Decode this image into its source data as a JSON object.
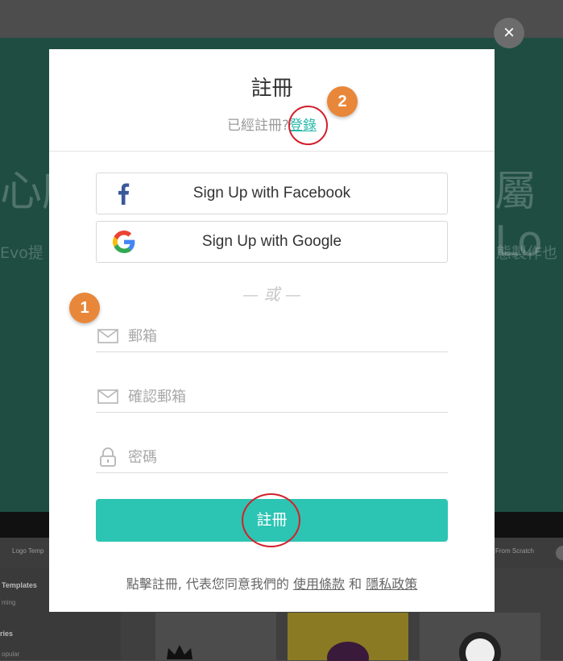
{
  "background": {
    "hero_left": "心所",
    "hero_right": "屬Lo",
    "hero_sub_left": "Evo提",
    "hero_sub_right": "態製作也",
    "nav_left": "Logo Temp",
    "nav_right": "From Scratch",
    "side_items": [
      "Templates",
      "ming",
      "ries",
      "opular"
    ]
  },
  "modal": {
    "close_label": "×",
    "title": "註冊",
    "already_registered": "已經註冊?",
    "login_link": "登錄",
    "facebook_label": "Sign Up with Facebook",
    "google_label": "Sign Up with Google",
    "or_text": "— 或 —",
    "email_placeholder": "郵箱",
    "confirm_email_placeholder": "確認郵箱",
    "password_placeholder": "密碼",
    "submit_label": "註冊",
    "terms_prefix": "點擊註冊, 代表您同意我們的",
    "terms_link": "使用條款",
    "terms_and": "和",
    "privacy_link": "隱私政策"
  },
  "annotations": {
    "badge_1": "1",
    "badge_2": "2"
  },
  "colors": {
    "accent": "#2cc4b3",
    "badge": "#e8873a",
    "ring": "#d4202c",
    "facebook": "#3b5998"
  }
}
